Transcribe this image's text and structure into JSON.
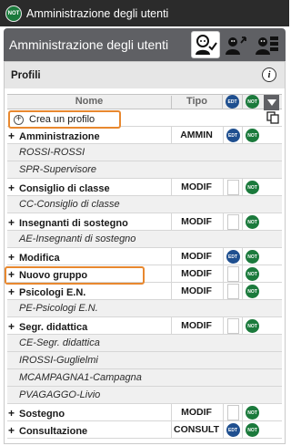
{
  "app": {
    "logo_label": "NOT",
    "window_title": "Amministrazione degli utenti"
  },
  "header": {
    "title": "Amministrazione degli utenti"
  },
  "panel": {
    "title": "Profili",
    "info_label": "i"
  },
  "columns": {
    "name": "Nome",
    "type": "Tipo",
    "edt": "EDT",
    "not": "NOT"
  },
  "create": {
    "label": "Crea un profilo"
  },
  "rows": [
    {
      "kind": "grp",
      "label": "Amministrazione",
      "type": "AMMIN",
      "edt": true,
      "not": true
    },
    {
      "kind": "sub",
      "label": "ROSSI-ROSSI"
    },
    {
      "kind": "sub",
      "label": "SPR-Supervisore"
    },
    {
      "kind": "grp",
      "label": "Consiglio di classe",
      "type": "MODIF",
      "edt": false,
      "not": true
    },
    {
      "kind": "sub",
      "label": "CC-Consiglio di classe"
    },
    {
      "kind": "grp",
      "label": "Insegnanti di sostegno",
      "type": "MODIF",
      "edt": false,
      "not": true
    },
    {
      "kind": "sub",
      "label": "AE-Insegnanti di sostegno"
    },
    {
      "kind": "grp",
      "label": "Modifica",
      "type": "MODIF",
      "edt": true,
      "not": true
    },
    {
      "kind": "grp",
      "label": "Nuovo gruppo",
      "type": "MODIF",
      "edt": false,
      "not": true
    },
    {
      "kind": "grp",
      "label": "Psicologi E.N.",
      "type": "MODIF",
      "edt": false,
      "not": true
    },
    {
      "kind": "sub",
      "label": "PE-Psicologi E.N."
    },
    {
      "kind": "grp",
      "label": "Segr. didattica",
      "type": "MODIF",
      "edt": false,
      "not": true
    },
    {
      "kind": "sub",
      "label": "CE-Segr. didattica"
    },
    {
      "kind": "sub",
      "label": "IROSSI-Guglielmi"
    },
    {
      "kind": "sub",
      "label": "MCAMPAGNA1-Campagna"
    },
    {
      "kind": "sub",
      "label": "PVAGAGGO-Livio"
    },
    {
      "kind": "grp",
      "label": "Sostegno",
      "type": "MODIF",
      "edt": false,
      "not": true
    },
    {
      "kind": "grp",
      "label": "Consultazione",
      "type": "CONSULT",
      "edt": true,
      "not": true
    }
  ],
  "colors": {
    "accent_orange": "#e8882f",
    "not_green": "#1b7a3c",
    "edt_blue": "#1f4f8f",
    "header_gray": "#5f6064"
  },
  "icons": {
    "header": [
      "user-admin-icon",
      "user-move-icon",
      "user-group-icon"
    ],
    "copy": "copy-icon",
    "menu": "triangle-down-icon"
  }
}
